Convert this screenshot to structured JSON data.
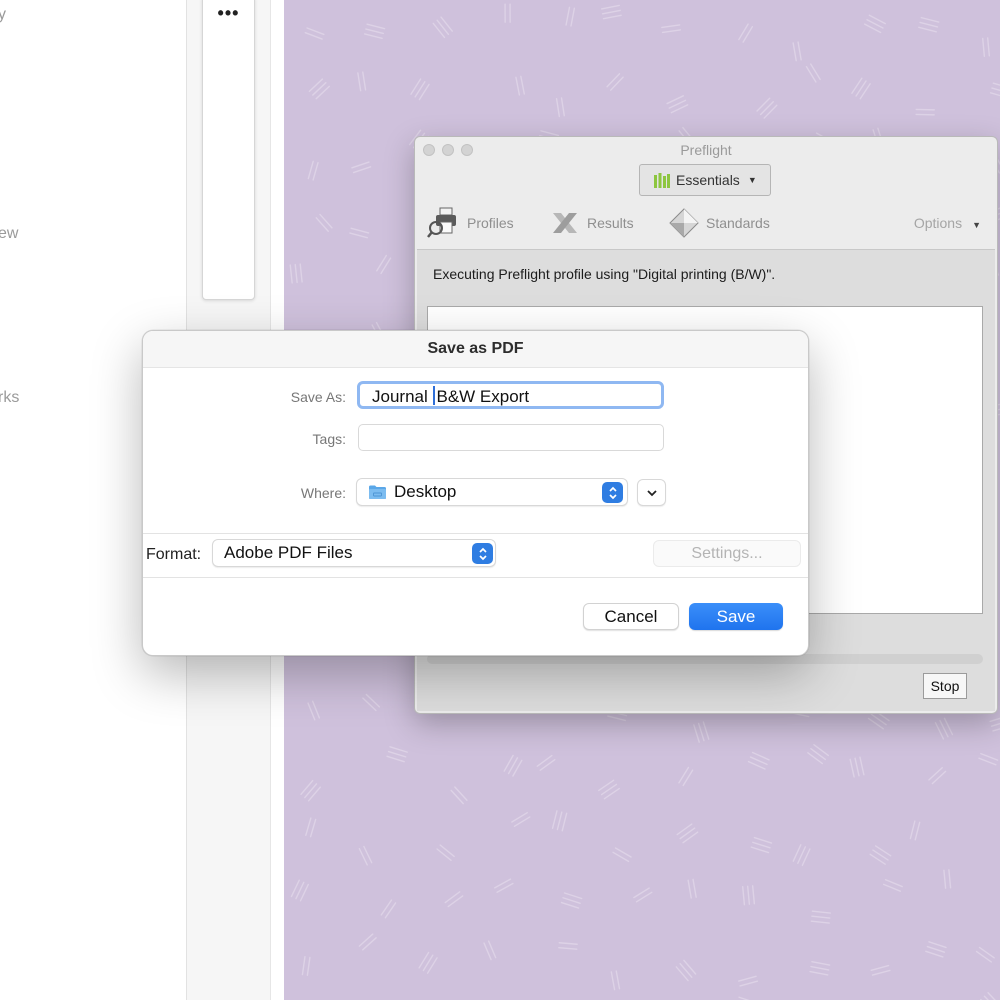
{
  "left_sidebar": {
    "fragments": [
      "y",
      "ew",
      "rks"
    ]
  },
  "side_menu": {
    "more_label": "•••"
  },
  "preflight": {
    "title": "Preflight",
    "profile_set": "Essentials",
    "tabs": [
      {
        "label": "Profiles",
        "icon": "profiles-icon"
      },
      {
        "label": "Results",
        "icon": "results-icon"
      },
      {
        "label": "Standards",
        "icon": "standards-icon"
      }
    ],
    "options_label": "Options",
    "status_message": "Executing Preflight profile using \"Digital printing (B/W)\".",
    "stop_label": "Stop"
  },
  "save_dialog": {
    "title": "Save as PDF",
    "save_as_label": "Save As:",
    "save_as_value_before_cursor": "Journal ",
    "save_as_value_after_cursor": "B&W Export",
    "tags_label": "Tags:",
    "tags_value": "",
    "where_label": "Where:",
    "where_value": "Desktop",
    "format_label": "Format:",
    "format_value": "Adobe PDF Files",
    "settings_label": "Settings...",
    "cancel_label": "Cancel",
    "save_label": "Save"
  },
  "colors": {
    "wallpaper": "#cfc1dc",
    "accent": "#1f74ee",
    "focus_ring": "#8fb8f2",
    "folder": "#5aa7e8",
    "essentials_icon": "#8dc63f"
  }
}
